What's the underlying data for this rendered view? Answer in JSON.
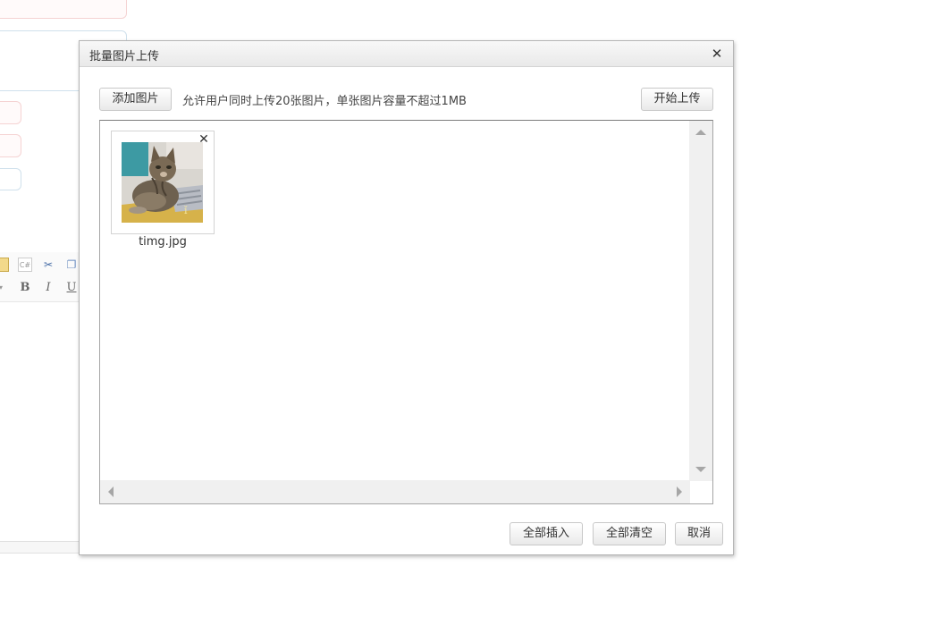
{
  "dialog": {
    "title": "批量图片上传",
    "close_icon": "close-icon",
    "add_button_label": "添加图片",
    "upload_tip": "允许用户同时上传20张图片，单张图片容量不超过1MB",
    "start_upload_label": "开始上传",
    "files": [
      {
        "name": "timg.jpg",
        "thumbnail": "cat-photo"
      }
    ],
    "footer": {
      "insert_all_label": "全部插入",
      "clear_all_label": "全部清空",
      "cancel_label": "取消"
    }
  },
  "background_toolbar": {
    "icons": [
      "paste-icon",
      "code-icon",
      "cut-icon",
      "copy-icon",
      "font-color-icon",
      "bold-icon",
      "italic-icon",
      "underline-icon"
    ],
    "bold_glyph": "B",
    "italic_glyph": "I",
    "underline_glyph": "U"
  },
  "colors": {
    "dialog_border": "#b5b5b5",
    "titlebar_top": "#f8f8f8",
    "titlebar_bottom": "#e9e9e9",
    "button_border": "#c8c8c8",
    "scrollbar": "#f0f0f0"
  }
}
